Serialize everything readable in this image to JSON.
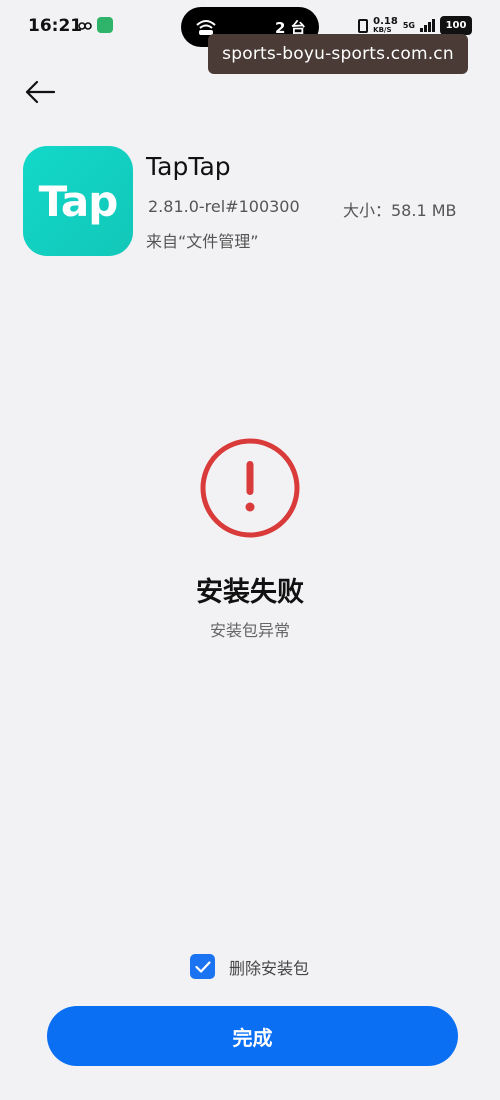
{
  "status_bar": {
    "time": "16:21",
    "island_text": "2 台",
    "net_speed_value": "0.18",
    "net_speed_unit": "KB/S",
    "signal_label": "5G",
    "battery": "100"
  },
  "watermark": "sports-boyu-sports.com.cn",
  "app": {
    "name": "TapTap",
    "icon_text": "Tap",
    "version": "2.81.0-rel#100300",
    "size": "大小：58.1 MB",
    "source": "来自“文件管理”"
  },
  "result": {
    "title": "安装失败",
    "subtitle": "安装包异常"
  },
  "delete_option": {
    "label": "删除安装包",
    "checked": true
  },
  "done_button": "完成",
  "colors": {
    "background": "#f2f2f5",
    "accent": "#0b6ff4",
    "error": "#d93a3a",
    "app_icon": "#12d8c9"
  },
  "icons": {
    "back": "arrow-left-icon",
    "error": "exclamation-circle-icon",
    "check": "checkmark-icon"
  }
}
